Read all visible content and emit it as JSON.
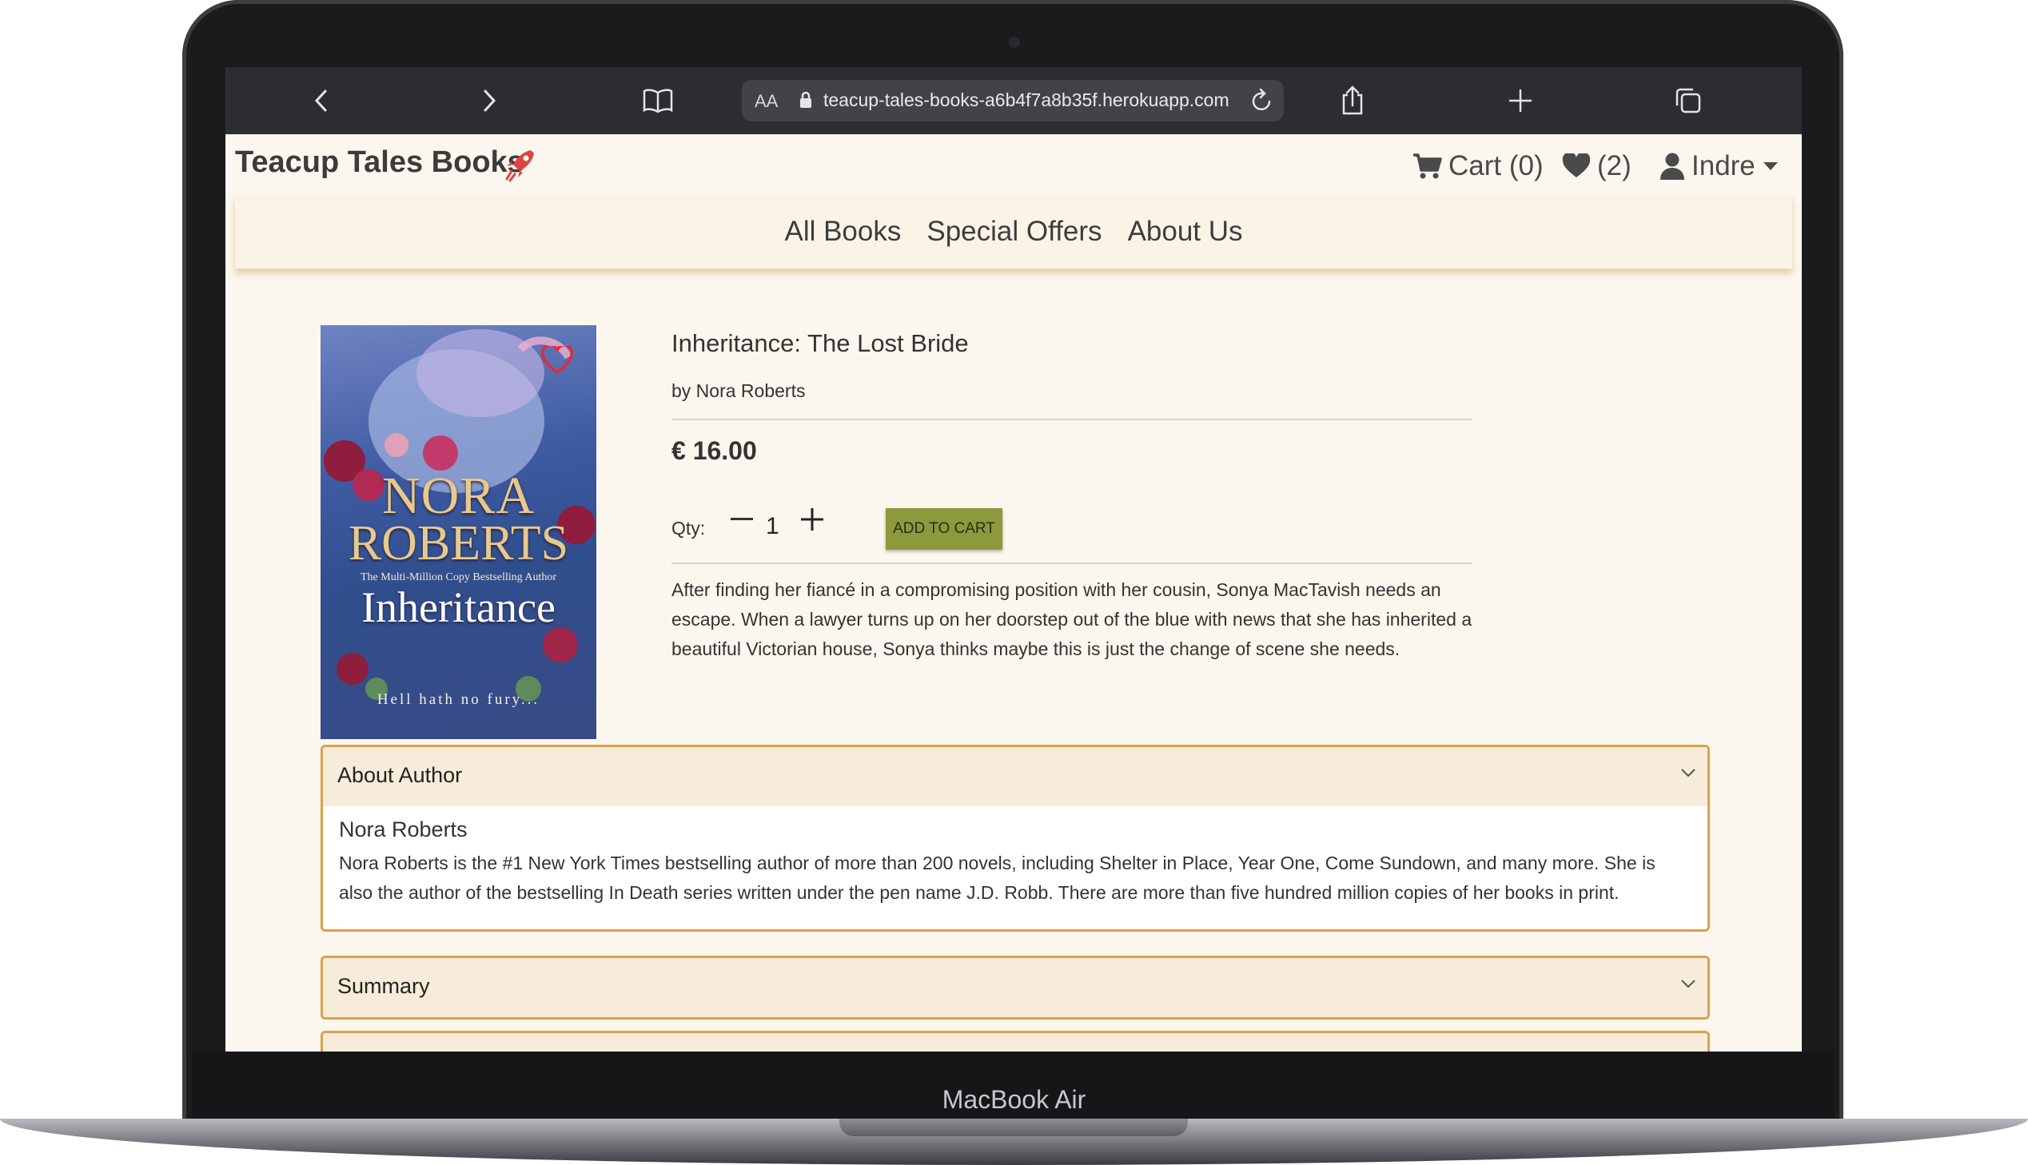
{
  "device": {
    "label": "MacBook Air"
  },
  "browser": {
    "url_aa": "AA",
    "url": "teacup-tales-books-a6b4f7a8b35f.herokuapp.com",
    "icons": [
      "back-icon",
      "forward-icon",
      "bookmarks-icon",
      "lock-icon",
      "reload-icon",
      "share-icon",
      "new-tab-icon",
      "tabs-icon"
    ]
  },
  "header": {
    "site_name": "Teacup Tales Books",
    "cart": "Cart (0)",
    "wishlist": "(2)",
    "user": "Indre"
  },
  "nav": {
    "items": [
      "All Books",
      "Special Offers",
      "About Us"
    ]
  },
  "product": {
    "title": "Inheritance: The Lost Bride",
    "author": "by Nora Roberts",
    "price": "€ 16.00",
    "qty_label": "Qty:",
    "qty_value": "1",
    "add_to_cart": "ADD TO CART",
    "description": "After finding her fiancé in a compromising position with her cousin, Sonya MacTavish needs an escape. When a lawyer turns up on her doorstep out of the blue with news that she has inherited a beautiful Victorian house, Sonya thinks maybe this is just the change of scene she needs.",
    "cover": {
      "author_line1": "NORA",
      "author_line2": "ROBERTS",
      "tagline": "The Multi-Million Copy Bestselling Author",
      "title": "Inheritance",
      "footer": "Hell hath no fury..."
    }
  },
  "accordion": {
    "about_author": {
      "title": "About Author",
      "name": "Nora Roberts",
      "text": "Nora Roberts is the #1 New York Times bestselling author of more than 200 novels, including Shelter in Place, Year One, Come Sundown, and many more. She is also the author of the bestselling In Death series written under the pen name J.D. Robb. There are more than five hundred million copies of her books in print."
    },
    "summary": {
      "title": "Summary"
    }
  },
  "colors": {
    "accent_border": "#d9a24a",
    "button": "#8c9a3c",
    "page_bg": "#fbf7ef",
    "logo_icon": "#e0443c"
  }
}
